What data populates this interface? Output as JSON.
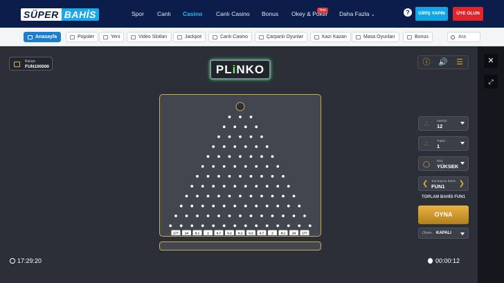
{
  "header": {
    "logo_super": "SÜPER",
    "logo_bahis": "BAHİS",
    "nav": [
      {
        "label": "Spor",
        "active": false
      },
      {
        "label": "Canlı",
        "active": false
      },
      {
        "label": "Casino",
        "active": true
      },
      {
        "label": "Canlı Casino",
        "active": false
      },
      {
        "label": "Bonus",
        "active": false
      },
      {
        "label": "Okey & Poker",
        "active": false
      },
      {
        "label": "Daha Fazla",
        "active": false
      }
    ],
    "new_badge": "Yeni",
    "help": "?",
    "login": "GİRİŞ YAPIN",
    "signup": "ÜYE OLUN"
  },
  "categories": [
    {
      "label": "Anasayfa",
      "active": true
    },
    {
      "label": "Popüler"
    },
    {
      "label": "Yeni"
    },
    {
      "label": "Video Slotları"
    },
    {
      "label": "Jackpot"
    },
    {
      "label": "Canlı Casino"
    },
    {
      "label": "Çarpanlı Oyunlar"
    },
    {
      "label": "Kazı Kazan"
    },
    {
      "label": "Masa Oyunları"
    },
    {
      "label": "Bonus"
    }
  ],
  "search_placeholder": "Ara",
  "game": {
    "balance_label": "Bakiye",
    "balance_value": "FUN100000",
    "logo_pl": "PL",
    "logo_i": "i",
    "logo_nko": "NKO",
    "rows": 12,
    "multipliers": [
      "177",
      "24",
      "8.1",
      "2",
      "0.7",
      "0.2",
      "0.2",
      "0.2",
      "0.7",
      "2",
      "8.1",
      "24",
      "177"
    ],
    "rows_label": "Satırlar",
    "rows_value": "12",
    "balls_label": "Toplar",
    "balls_value": "1",
    "risk_label": "Risk",
    "risk_value": "YÜKSEK",
    "bet_label": "Top Başına Bahis",
    "bet_value": "FUN1",
    "total_bet": "TOPLAM BAHİS FUN1",
    "play": "OYNA",
    "auto_label": "Otom.",
    "auto_value": "KAPALI",
    "clock": "17:29:20",
    "timer": "00:00:12"
  },
  "colors": {
    "header_bg": "#0b1d4a",
    "accent_blue": "#13a4e4",
    "signup_red": "#e0262b",
    "gold": "#d4a94a",
    "logo_green": "#6cf26d"
  }
}
